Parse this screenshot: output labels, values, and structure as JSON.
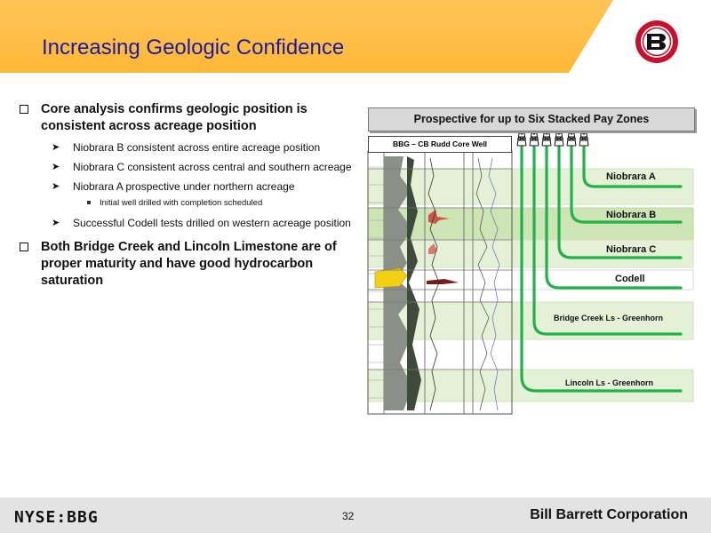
{
  "slide": {
    "title": "Increasing Geologic Confidence",
    "page_number": "32"
  },
  "bullets": {
    "b1_text": "Core analysis confirms geologic position is consistent across acreage position",
    "b1_sub1": "Niobrara B consistent across entire acreage position",
    "b1_sub2": "Niobrara C consistent across central and southern acreage",
    "b1_sub3": "Niobrara A prospective under northern acreage",
    "b1_sub3_detail": "Initial well drilled with completion scheduled",
    "b1_sub4": "Successful Codell tests drilled on western acreage position",
    "b2_text": "Both Bridge Creek and Lincoln Limestone are of proper maturity and have good hydrocarbon saturation"
  },
  "diagram": {
    "banner": "Prospective for up to Six Stacked Pay Zones",
    "well_label": "BBG – CB Rudd Core Well",
    "zones": {
      "niobrara_a": "Niobrara A",
      "niobrara_b": "Niobrara B",
      "niobrara_c": "Niobrara C",
      "codell": "Codell",
      "bridge_creek": "Bridge Creek Ls - Greenhorn",
      "lincoln": "Lincoln Ls - Greenhorn"
    },
    "rig_count": 6
  },
  "footer": {
    "ticker": "NYSE:BBG",
    "company": "Bill Barrett Corporation"
  },
  "colors": {
    "header": "#ffb838",
    "title": "#1c1aa0",
    "zone_band": "#e4f1d6",
    "zone_band_highlight": "#cde5b4",
    "pipe": "#22b04b",
    "logo_red": "#c8102e",
    "footer_bg": "#e3e3e3"
  }
}
